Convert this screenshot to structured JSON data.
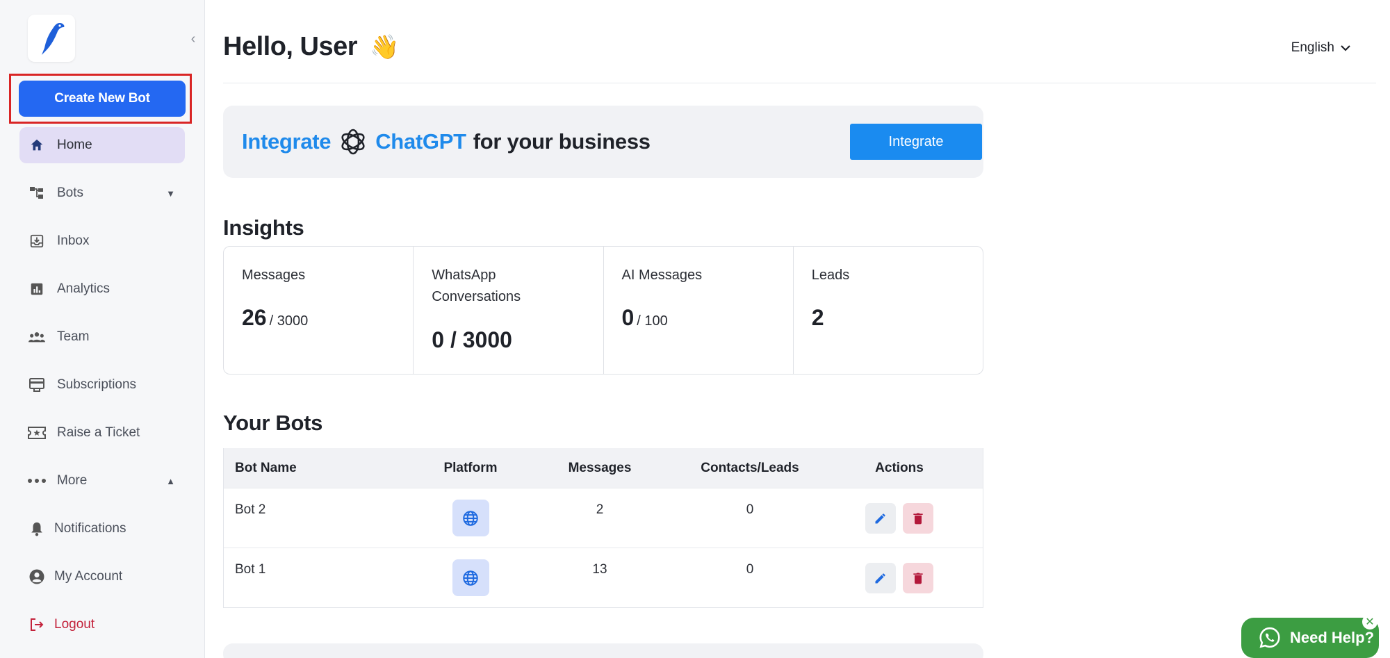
{
  "sidebar": {
    "create_button": "Create New Bot",
    "items": [
      {
        "label": "Home",
        "icon": "home-icon"
      },
      {
        "label": "Bots",
        "icon": "bots-icon"
      },
      {
        "label": "Inbox",
        "icon": "inbox-icon"
      },
      {
        "label": "Analytics",
        "icon": "analytics-icon"
      },
      {
        "label": "Team",
        "icon": "team-icon"
      },
      {
        "label": "Subscriptions",
        "icon": "subscriptions-icon"
      },
      {
        "label": "Raise a Ticket",
        "icon": "ticket-icon"
      },
      {
        "label": "More",
        "icon": "more-icon"
      },
      {
        "label": "Notifications",
        "icon": "bell-icon"
      },
      {
        "label": "My Account",
        "icon": "account-icon"
      },
      {
        "label": "Logout",
        "icon": "logout-icon"
      }
    ]
  },
  "header": {
    "greeting": "Hello, User",
    "wave": "👋",
    "language": "English"
  },
  "banner": {
    "integrate_word": "Integrate",
    "product": "ChatGPT",
    "rest": "for your business",
    "button": "Integrate"
  },
  "insights": {
    "title": "Insights",
    "cards": [
      {
        "label": "Messages",
        "value": "26",
        "sub": "/ 3000"
      },
      {
        "label": "WhatsApp Conversations",
        "value": "0 / 3000",
        "sub": ""
      },
      {
        "label": "AI Messages",
        "value": "0",
        "sub": "/ 100"
      },
      {
        "label": "Leads",
        "value": "2",
        "sub": ""
      }
    ]
  },
  "bots": {
    "title": "Your Bots",
    "columns": [
      "Bot Name",
      "Platform",
      "Messages",
      "Contacts/Leads",
      "Actions"
    ],
    "rows": [
      {
        "name": "Bot 2",
        "messages": "2",
        "contacts": "0"
      },
      {
        "name": "Bot 1",
        "messages": "13",
        "contacts": "0"
      }
    ]
  },
  "help": {
    "label": "Need Help?",
    "close": "✕"
  },
  "colors": {
    "primary": "#2468f2",
    "accent_blue": "#1f8aeb",
    "active_nav": "#e2ddf5",
    "danger": "#c3223b",
    "whatsapp_green": "#3c9d42"
  }
}
